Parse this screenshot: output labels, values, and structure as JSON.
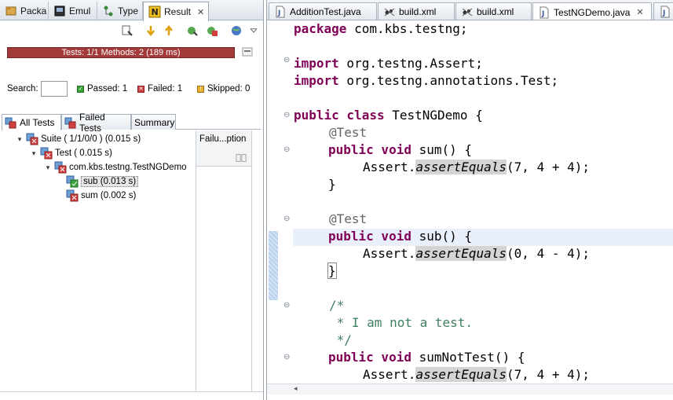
{
  "left_view": {
    "tabs": [
      {
        "label": "Packa",
        "icon": "package-explorer-icon"
      },
      {
        "label": "Emul",
        "icon": "emulator-icon"
      },
      {
        "label": "Type",
        "icon": "type-hierarchy-icon"
      },
      {
        "label": "Result",
        "icon": "testng-icon",
        "active": true
      }
    ],
    "progress_text": "Tests: 1/1  Methods: 2 (189 ms)",
    "progress_status": "failed",
    "search_label": "Search:",
    "search_value": "",
    "passed_label": "Passed: 1",
    "failed_label": "Failed: 1",
    "skipped_label": "Skipped: 0",
    "subtabs": [
      "All Tests",
      "Failed Tests",
      "Summary"
    ],
    "tree": [
      {
        "label": "Suite ( 1/1/0/0 ) (0.015 s)",
        "status": "failed",
        "expanded": true
      },
      {
        "label": "Test ( 0.015 s)",
        "status": "failed",
        "expanded": true
      },
      {
        "label": "com.kbs.testng.TestNGDemo",
        "status": "failed",
        "expanded": true
      },
      {
        "label": "sub  (0.013 s)",
        "status": "passed",
        "selected": true
      },
      {
        "label": "sum  (0.002 s)",
        "status": "failed"
      }
    ],
    "failure_header": "Failu...ption"
  },
  "editor": {
    "tabs": [
      {
        "label": "AdditionTest.java",
        "icon": "java-file-icon"
      },
      {
        "label": "build.xml",
        "icon": "ant-file-icon"
      },
      {
        "label": "build.xml",
        "icon": "ant-file-icon"
      },
      {
        "label": "TestNGDemo.java",
        "icon": "java-file-icon",
        "active": true
      }
    ],
    "code": {
      "l1_kw": "package",
      "l1_rest": " com.kbs.testng;",
      "l2_kw": "import",
      "l2_rest": " org.testng.Assert;",
      "l3_kw": "import",
      "l3_rest": " org.testng.annotations.Test;",
      "l4_kw": "public class",
      "l4_rest": " TestNGDemo {",
      "ann": "@Test",
      "pv": "public void",
      "sum_sig": " sum() {",
      "assert_pre": "Assert.",
      "assert_m": "assertEquals",
      "sum_args": "(7, 4 + 4);",
      "close": "}",
      "sub_sig": " sub() {",
      "sub_args": "(0, 4 - 4);",
      "c1": "/*",
      "c2": " * I am not a test.",
      "c3": " */",
      "snt_sig": " sumNotTest() {",
      "snt_args": "(7, 4 + 4);"
    }
  }
}
